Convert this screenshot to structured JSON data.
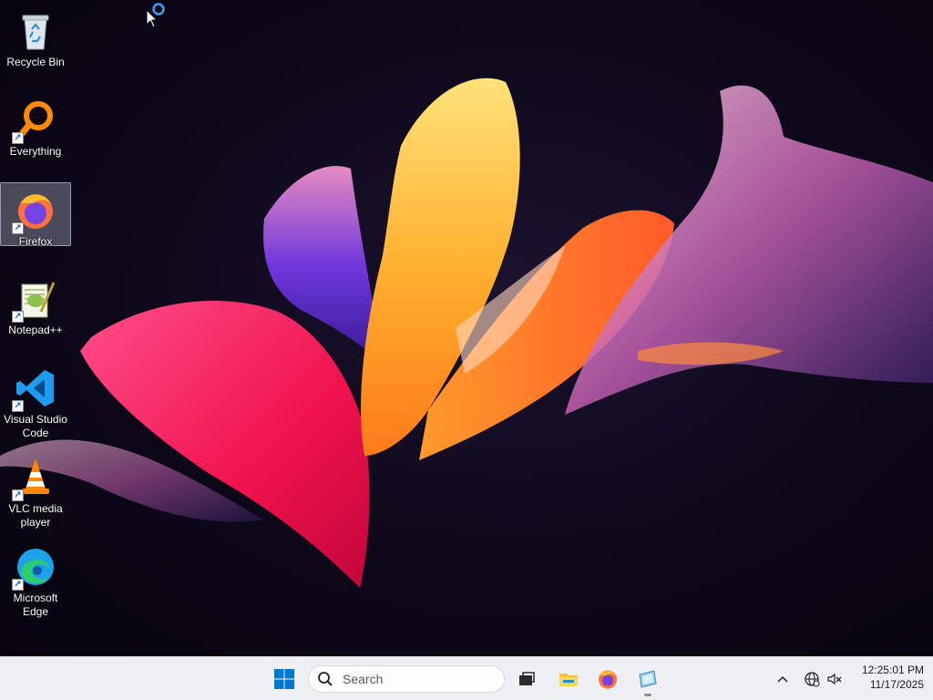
{
  "desktop": {
    "icons": [
      {
        "label": "Recycle Bin",
        "icon": "recycle-bin-icon",
        "shortcut": false,
        "selected": false
      },
      {
        "label": "Everything",
        "icon": "everything-search-icon",
        "shortcut": true,
        "selected": false
      },
      {
        "label": "Firefox",
        "icon": "firefox-icon",
        "shortcut": true,
        "selected": true
      },
      {
        "label": "Notepad++",
        "icon": "notepad-plus-plus-icon",
        "shortcut": true,
        "selected": false
      },
      {
        "label": "Visual Studio Code",
        "icon": "vscode-icon",
        "shortcut": true,
        "selected": false
      },
      {
        "label": "VLC media player",
        "icon": "vlc-icon",
        "shortcut": true,
        "selected": false
      },
      {
        "label": "Microsoft Edge",
        "icon": "edge-icon",
        "shortcut": true,
        "selected": false
      }
    ],
    "cursor": "busy-pointer-icon"
  },
  "taskbar": {
    "start_icon": "windows-start-icon",
    "search": {
      "placeholder": "Search",
      "value": ""
    },
    "apps": [
      {
        "name": "Task View",
        "icon": "task-view-icon",
        "running": false
      },
      {
        "name": "File Explorer",
        "icon": "file-explorer-icon",
        "running": false
      },
      {
        "name": "Firefox",
        "icon": "firefox-icon",
        "running": false
      },
      {
        "name": "Application",
        "icon": "generic-app-icon",
        "running": true
      }
    ],
    "tray": {
      "chevron": "chevron-up-icon",
      "network": "network-globe-icon",
      "volume": "volume-muted-icon",
      "time": "12:25:01 PM",
      "date": "11/17/2025"
    }
  },
  "colors": {
    "taskbar_bg": "#eef0f5",
    "accent": "#0078d4",
    "desktop_bg": "#0d0818"
  }
}
